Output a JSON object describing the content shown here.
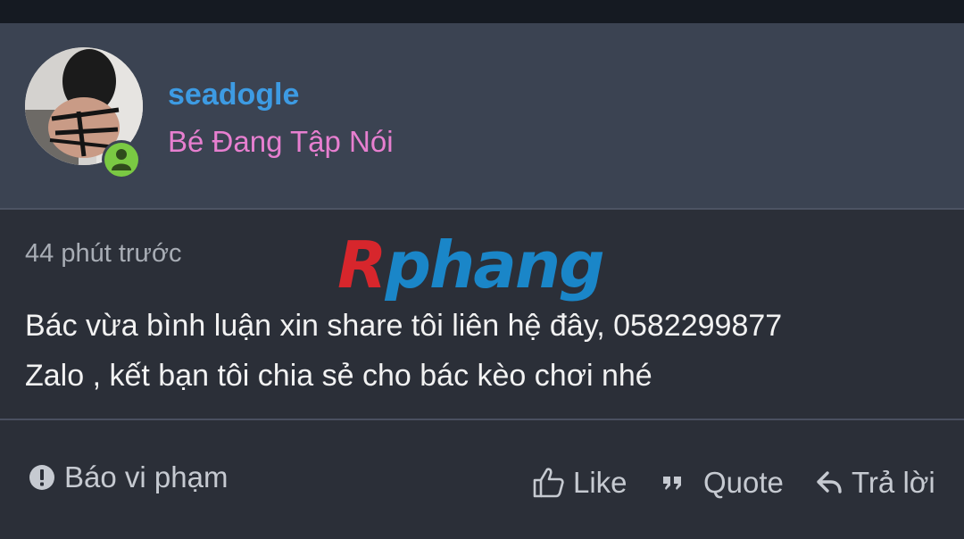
{
  "user": {
    "username": "seadogle",
    "title": "Bé Đang Tập Nói"
  },
  "post": {
    "time": "44 phút trước",
    "content_line1": "Bác vừa bình luận xin share tôi liên hệ đây, 0582299877",
    "content_line2": "Zalo , kết bạn tôi chia sẻ cho bác kèo chơi nhé",
    "watermark_r": "R",
    "watermark_rest": "phang"
  },
  "actions": {
    "report_label": "Báo vi phạm",
    "like_label": "Like",
    "quote_label": "Quote",
    "reply_label": "Trả lời"
  },
  "colors": {
    "username": "#3d9be3",
    "user_title": "#e77fd0",
    "online": "#7ac943",
    "header_bg": "#3b4352",
    "body_bg": "#2b2f38"
  },
  "icons": [
    "avatar-image",
    "online-status-icon",
    "warning-icon",
    "thumbs-up-icon",
    "quote-icon",
    "reply-icon"
  ]
}
